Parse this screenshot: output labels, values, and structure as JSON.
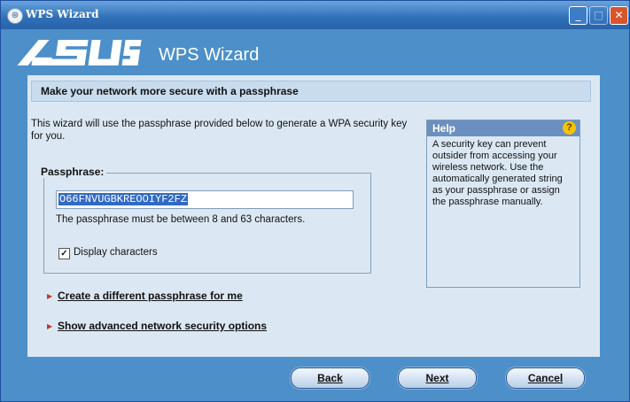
{
  "window": {
    "title": "WPS Wizard"
  },
  "header": {
    "logo": "/ISUS",
    "title": "WPS Wizard"
  },
  "section": {
    "heading": "Make your network more secure with a passphrase"
  },
  "intro": "This wizard will use the passphrase provided below to generate a WPA security key for you.",
  "passphrase": {
    "legend": "Passphrase:",
    "value": "O66FNVUGBKREOOIYF2FZ",
    "hint": "The passphrase must be between 8 and 63 characters.",
    "display_label": "Display characters",
    "display_checked": true
  },
  "help": {
    "title": "Help",
    "icon": "question-icon",
    "text": "A security key can prevent outsider from accessing your wireless network. Use the automatically generated string as your passphrase or assign the passphrase manually."
  },
  "links": {
    "create": "Create a different passphrase for me",
    "advanced": "Show advanced network security options"
  },
  "buttons": {
    "back": "Back",
    "next": "Next",
    "cancel": "Cancel"
  },
  "colors": {
    "titlebar": "#2f6fb7",
    "frame": "#4d8fc9",
    "panel": "#dbe8f4",
    "close": "#d9542c",
    "help_icon": "#f5c400",
    "selection": "#316ac5"
  }
}
